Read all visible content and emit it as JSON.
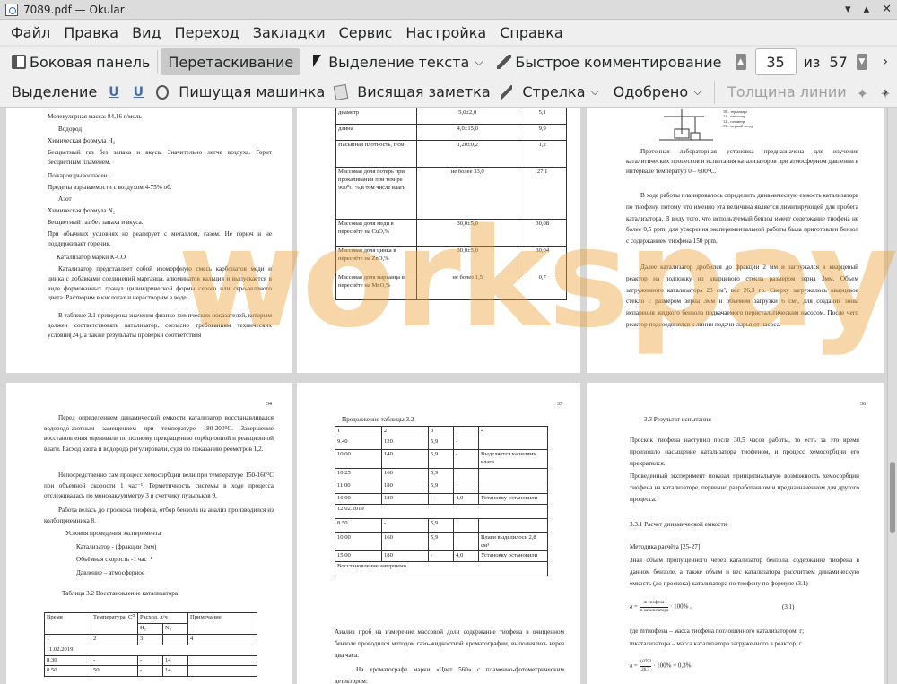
{
  "window": {
    "title": "7089.pdf  — Okular"
  },
  "menu": [
    "Файл",
    "Правка",
    "Вид",
    "Переход",
    "Закладки",
    "Сервис",
    "Настройка",
    "Справка"
  ],
  "toolbar1": {
    "sidebar": "Боковая панель",
    "drag": "Перетаскивание",
    "text_select": "Выделение текста",
    "quick_comment": "Быстрое комментирование",
    "page_current": "35",
    "page_of": "из",
    "page_total": "57"
  },
  "toolbar2": {
    "selection": "Выделение",
    "typewriter": "Пишущая машинка",
    "pop_note": "Висящая заметка",
    "arrow": "Стрелка",
    "stamp": "Одобрено",
    "line_width": "Толщина линии"
  },
  "watermark": "workspay.ru",
  "page1": {
    "lines": [
      "Молекулярная масса: 84,16 г/моль",
      "Водород",
      "Химическая формула H₂",
      "Бесцветный газ без запаха и вкуса. Значительно легче воздуха. Горит бесцветным пламенем.",
      "Пожаровзрывоопасен.",
      "Пределы взрываемости с воздухом 4-75% об.",
      "Азот",
      "Химическая формула N₂",
      "Бесцветный газ без запаха и вкуса.",
      "При обычных условиях не реагирует с металлом, газом. Не горюч и не поддерживает горения.",
      "Катализатор марки К-СО",
      "Катализатор представляет собой изоморфную смесь карбонатов меди и цинка с добавками соединений марганца, алюминатов кальция и выпускается в виде формованных гранул цилиндрической формы серого или серо-зеленого цвета. Растворим в кислотах и нерастворим в воде.",
      "В таблице 3.1 приведены значения физико-химических показателей, которым должен соответствовать катализатор, согласно требованиям технических условий[24], а также результаты проверки соответствия"
    ]
  },
  "page2": {
    "rows": [
      [
        "диаметр",
        "5,0±2,0",
        "5,1"
      ],
      [
        "длина",
        "4,0±15,0",
        "9,9"
      ],
      [
        "Насыпная плотность, г/см³",
        "1,20±0,2",
        "1,2"
      ],
      [
        "Массовая доля потерь при прокаливании при тем-ре 900⁰С %,в том числе влаги",
        "не более 33,0",
        "27,1"
      ],
      [
        "Массовая доля меди в пересчёте на CuO,%",
        "30,0±5,0",
        "30,08"
      ],
      [
        "Массовая доля цинка в пересчёте на ZnO,%",
        "30,0±5,0",
        "30,04"
      ],
      [
        "Массовая доля марганца в пересчёте на MnO,%",
        "не более 1,5",
        "0,7"
      ]
    ]
  },
  "page3": {
    "legend": [
      "10 – термопара",
      "11 – капилляр",
      "12 – газометр",
      "13 – мерный сосуд"
    ],
    "paragraphs": [
      "Проточная лабораторная установка предназначена для изучения каталитических процессов и испытания катализаторов при атмосферном давлении в интервале температур 0 – 600⁰С.",
      "В ходе работы планировалось определить динамическую емкость катализатора по тиофену, потому что именно эта величина является лимитирующей для пробега катализатора. В виду того, что используемый бензол имеет содержание тиофена не более 0,5 ppm, для ускорения экспериментальной работы была приготовлен бензол с содержанием тиофена 150 ppm.",
      "Далее катализатор дробился до фракции 2 мм и загружался в кварцевый реактор на подложку из кварцевого стекла размером зерна 3мм. Объем загруженного катализатора 23 см³, вес 26,3 гр. Сверху загружалось кварцевое стекло с размером зерна 3мм и объемом загрузки 6 см³, для создания зоны испарения жидкого бензола подкачаемого перистальтическим насосом. После чего реактор подсоединялся к линии подачи сырья от насоса."
    ]
  },
  "page4": {
    "number": "34",
    "paragraphs": [
      "Перед определением динамической емкости катализатор восстанавливался водородо-азотным замещением при температуре 180-200⁰С. Завершение восстановления оценивали по полному прекращению сорбционной и реакционной влаги. Расход азота и водорода регулировали, судя по показанию реометров 1,2.",
      "Непосредственно сам процесс хемосорбции вели при температуре 150-160⁰С при объемной скорости 1 час⁻¹. Герметичность системы в ходе процесса отслеживалась по моновакуумметру 3 и счетчику пузырьков 9.",
      "Работа велась до проскока тиофена, отбор бензола на анализ производился из колбоприемника 8."
    ],
    "conditions_title": "Условия проведения эксперимента",
    "conditions": [
      "Катализатор - (фракции 2мм)",
      "Объёмная скорость -1 час⁻¹",
      "Давление – атмосферное"
    ],
    "table_title": "Таблица 3.2 Восстановление катализатора",
    "table_head": [
      "Время",
      "Температура, C⁰",
      "Расход, л/ч",
      "Примечание"
    ],
    "table_sub": [
      "H₂",
      "N₂"
    ],
    "table_nums": [
      "1",
      "2",
      "3",
      "",
      "4"
    ],
    "table_date": "11.02.2019",
    "table_rows": [
      [
        "8.30",
        "-",
        "-",
        "14",
        ""
      ],
      [
        "8.50",
        "50",
        "-",
        "14",
        ""
      ]
    ]
  },
  "page5": {
    "number": "35",
    "caption": "Продолжение таблицы 3.2",
    "head": [
      "1",
      "2",
      "3",
      "",
      "4"
    ],
    "rows": [
      [
        "9.40",
        "120",
        "5,9",
        "-",
        ""
      ],
      [
        "10.00",
        "140",
        "5,9",
        "-",
        "Выделяется капилями влага"
      ],
      [
        "10.25",
        "160",
        "5,9",
        "",
        ""
      ],
      [
        "11.00",
        "180",
        "5,9",
        "",
        ""
      ],
      [
        "16.00",
        "180",
        "-",
        "4,0",
        "Установку остановили"
      ],
      [
        "12.02.2019",
        "",
        "",
        "",
        ""
      ],
      [
        "8.50",
        "-",
        "5,9",
        "",
        ""
      ],
      [
        "10.00",
        "160",
        "5,9",
        "",
        "Влаги выделилось 2,8 см³"
      ],
      [
        "15.00",
        "180",
        "-",
        "4,0",
        "Установку остановили"
      ],
      [
        "Восстановление завершено",
        "",
        "",
        "",
        ""
      ]
    ],
    "paragraphs": [
      "Анализ проб на измерение массовой доли содержание тиофена в очищенном бензоле проводился методом газо-жидкостной хроматографии, выполнялись через два часа.",
      "На хроматографе марки «Цвет 560» с пламенно-фотометрическим детектором:"
    ]
  },
  "page6": {
    "number": "36",
    "heading": "3.3 Результат испытания",
    "paragraphs": [
      "Проскок тиофена наступил после 30,5 часов работы, то есть за это время произошло насыщение катализатора тиофеном, и процесс хемосорбции его прекратился.",
      "Проведенный эксперимент показал принципиальную возможность хемосорбции тиофена на катализаторе, первично разработанном и предназначенном для другого процесса."
    ],
    "subheading": "3.3.1 Расчет динамической емкости",
    "method": "Методика расчёта [25-27]",
    "method_text": "Зная объем пропущенного через катализатор бензола, содержание тиофена в данном бензоле, а также объем и вес катализатора рассчитаем динамическую емкость (до проскока) катализатора по тиофену по формуле (3.1)",
    "formula_prefix": "a =",
    "formula_num": "m тиофена",
    "formula_den": "m катализатора",
    "formula_suffix": "· 100% ,",
    "formula_label": "(3.1)",
    "where1": "где mтиофена – масса тиофена поглощенного катализатором, г;",
    "where2": "mкатализатора – масса катализатора загруженного в реактор, г.",
    "calc_prefix": "a =",
    "calc_num": "0,0792",
    "calc_den": "26,3",
    "calc_suffix": "· 100% = 0,3%"
  }
}
